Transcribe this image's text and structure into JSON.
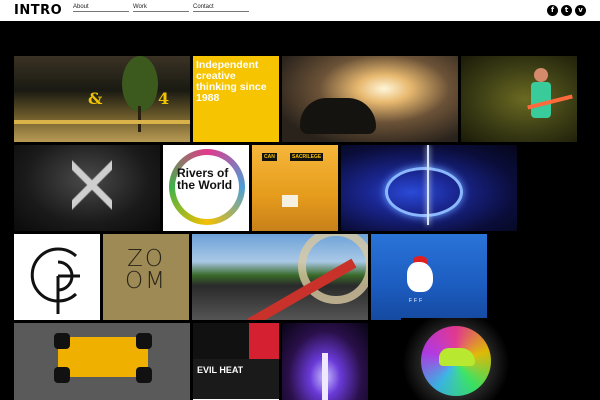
{
  "header": {
    "logo": "INTRO",
    "nav": [
      {
        "label": "About"
      },
      {
        "label": "Work"
      },
      {
        "label": "Contact"
      }
    ],
    "social": [
      {
        "icon": "facebook-icon",
        "glyph": "f"
      },
      {
        "icon": "twitter-icon",
        "glyph": "t"
      },
      {
        "icon": "vimeo-icon",
        "glyph": "v"
      }
    ]
  },
  "tiles": {
    "tagline": "Independent creative thinking since 1988",
    "store_sign_left": "&",
    "store_sign_right": "4",
    "rivers": "Rivers of the World",
    "sacrilege_1": "CAN",
    "sacrilege_2": "SACRILEGE",
    "zoom": "ZO OM",
    "rooster_badge": "FFF",
    "collage_text": "EVIL HEAT"
  },
  "colors": {
    "tagline_bg": "#f6c400",
    "page_bg": "#000000",
    "header_bg": "#ffffff"
  }
}
